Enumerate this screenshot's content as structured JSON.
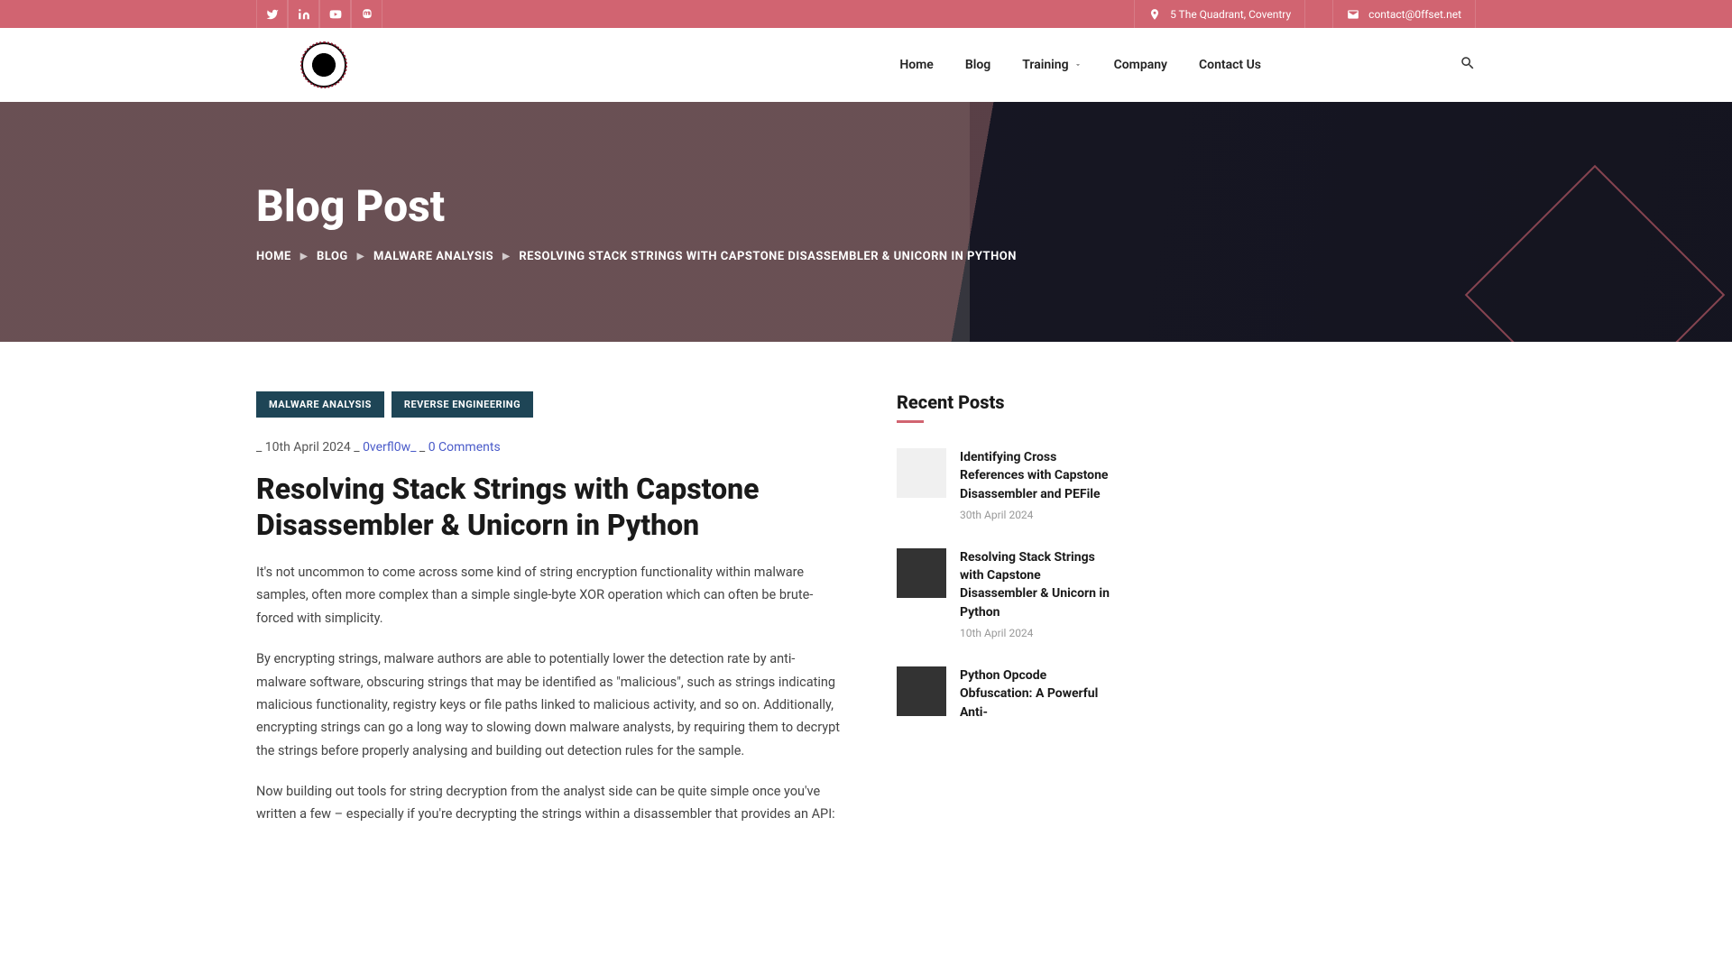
{
  "topbar": {
    "address": "5 The Quadrant, Coventry",
    "email": "contact@0ffset.net"
  },
  "nav": {
    "home": "Home",
    "blog": "Blog",
    "training": "Training",
    "company": "Company",
    "contact": "Contact Us"
  },
  "hero": {
    "title": "Blog Post",
    "breadcrumb": {
      "home": "HOME",
      "blog": "BLOG",
      "category": "MALWARE ANALYSIS",
      "current": "RESOLVING STACK STRINGS WITH CAPSTONE DISASSEMBLER & UNICORN IN PYTHON"
    }
  },
  "article": {
    "tags": [
      "MALWARE ANALYSIS",
      "REVERSE ENGINEERING"
    ],
    "meta": {
      "date": "10th April 2024",
      "author": "0verfl0w_",
      "comments": "0 Comments"
    },
    "title": "Resolving Stack Strings with Capstone Disassembler & Unicorn in Python",
    "paragraphs": [
      "It's not uncommon to come across some kind of string encryption functionality within malware samples, often more complex than a simple single-byte XOR operation which can often be brute-forced with simplicity.",
      "By encrypting strings, malware authors are able to potentially lower the detection rate by anti-malware software, obscuring strings that may be identified as \"malicious\", such as strings indicating malicious functionality, registry keys or file paths linked to malicious activity, and so on. Additionally, encrypting strings can go a long way to slowing down malware analysts, by requiring them to decrypt the strings before properly analysing and building out detection rules for the sample.",
      "Now building out tools for string decryption from the analyst side can be quite simple once you've written a few – especially if you're decrypting the strings within a disassembler that provides an API:"
    ]
  },
  "sidebar": {
    "title": "Recent Posts",
    "posts": [
      {
        "title": "Identifying Cross References with Capstone Disassembler and PEFile",
        "date": "30th April 2024"
      },
      {
        "title": "Resolving Stack Strings with Capstone Disassembler & Unicorn in Python",
        "date": "10th April 2024"
      },
      {
        "title": "Python Opcode Obfuscation: A Powerful Anti-",
        "date": ""
      }
    ]
  }
}
